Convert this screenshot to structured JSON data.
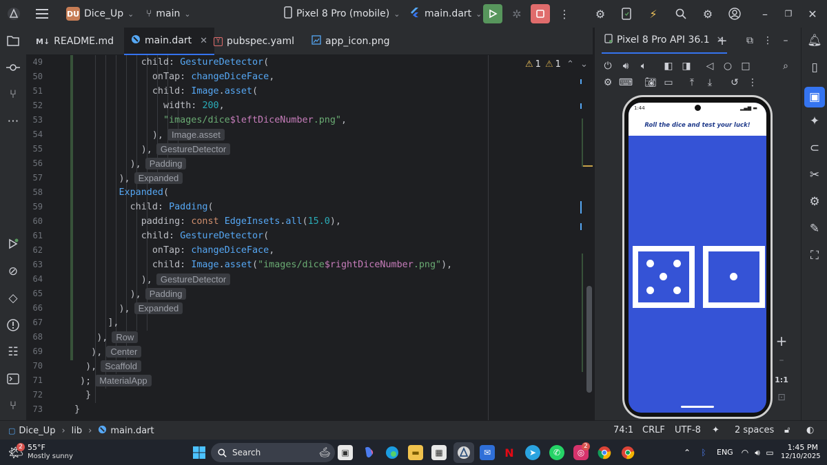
{
  "topbar": {
    "project_badge": "DU",
    "project_name": "Dice_Up",
    "branch": "main",
    "device": "Pixel 8 Pro (mobile)",
    "run_config": "main.dart"
  },
  "tabs": [
    {
      "label": "README.md",
      "icon": "M↓"
    },
    {
      "label": "main.dart",
      "active": true
    },
    {
      "label": "pubspec.yaml"
    },
    {
      "label": "app_icon.png"
    }
  ],
  "editor": {
    "warnings_1": "1",
    "warnings_2": "1",
    "line_numbers": [
      "49",
      "50",
      "51",
      "52",
      "53",
      "54",
      "55",
      "56",
      "57",
      "58",
      "59",
      "60",
      "61",
      "62",
      "63",
      "64",
      "65",
      "66",
      "67",
      "68",
      "69",
      "70",
      "71",
      "72",
      "73"
    ],
    "hints": {
      "h54": "Image.asset",
      "h55": "GestureDetector",
      "h56": "Padding",
      "h57": "Expanded",
      "h64": "GestureDetector",
      "h65": "Padding",
      "h66": "Expanded",
      "h68": "Row",
      "h69": "Center",
      "h70": "Scaffold",
      "h71": "MaterialApp"
    }
  },
  "device_panel": {
    "tab_label": "Pixel 8 Pro API 36.1",
    "zoom_label": "1:1",
    "phone": {
      "time": "1:44",
      "title": "Roll the dice and test your luck!",
      "left_die": 5,
      "right_die": 1,
      "bg_color": "#3553d6"
    }
  },
  "status": {
    "crumb_project": "Dice_Up",
    "crumb_folder": "lib",
    "crumb_file": "main.dart",
    "position": "74:1",
    "line_ending": "CRLF",
    "encoding": "UTF-8",
    "indent": "2 spaces"
  },
  "taskbar": {
    "weather_temp": "55°F",
    "weather_desc": "Mostly sunny",
    "weather_badge": "2",
    "search": "Search",
    "lang": "ENG",
    "time": "1:45 PM",
    "date": "12/10/2025"
  }
}
